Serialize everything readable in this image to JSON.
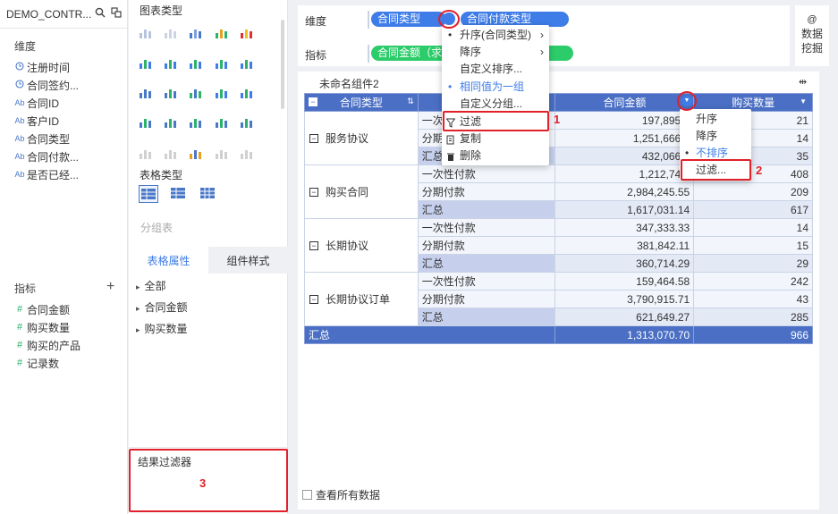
{
  "left": {
    "title": "DEMO_CONTR...",
    "dim_title": "维度",
    "dims": [
      {
        "icon": "clock-icon",
        "label": "注册时间"
      },
      {
        "icon": "clock-icon",
        "label": "合同签约..."
      },
      {
        "icon": "text-icon",
        "label": "合同ID"
      },
      {
        "icon": "text-icon",
        "label": "客户ID"
      },
      {
        "icon": "text-icon",
        "label": "合同类型"
      },
      {
        "icon": "text-icon",
        "label": "合同付款..."
      },
      {
        "icon": "text-icon",
        "label": "是否已经..."
      }
    ],
    "measure_title": "指标",
    "measures": [
      {
        "label": "合同金额"
      },
      {
        "label": "购买数量"
      },
      {
        "label": "购买的产品"
      },
      {
        "label": "记录数"
      }
    ],
    "text_icon": "Ab",
    "measure_icon": "#"
  },
  "mid": {
    "chart_type": "图表类型",
    "table_type": "表格类型",
    "group_table": "分组表",
    "tab_attr": "表格属性",
    "tab_style": "组件样式",
    "attrs": [
      "全部",
      "合同金额",
      "购买数量"
    ],
    "result_filter": "结果过滤器"
  },
  "config": {
    "dim_label": "维度",
    "dim_pills": [
      "合同类型",
      "合同付款类型"
    ],
    "measure_label": "指标",
    "measure_pill": "合同金额（求和）",
    "mining": "数据挖掘",
    "mining_icon_text": "@"
  },
  "widget": {
    "title": "未命名组件2"
  },
  "table": {
    "headers": [
      "合同类型",
      "合同付款类型",
      "合同金额",
      "购买数量"
    ],
    "groups": [
      {
        "name": "服务协议",
        "rows": [
          [
            "一次性付款",
            "197,895.2",
            "21"
          ],
          [
            "分期付款",
            "1,251,666.0",
            "14"
          ],
          [
            "汇总",
            "432,066.0",
            "35"
          ]
        ]
      },
      {
        "name": "购买合同",
        "rows": [
          [
            "一次性付款",
            "1,212,747.",
            "408"
          ],
          [
            "分期付款",
            "2,984,245.55",
            "209"
          ],
          [
            "汇总",
            "1,617,031.14",
            "617"
          ]
        ]
      },
      {
        "name": "长期协议",
        "rows": [
          [
            "一次性付款",
            "347,333.33",
            "14"
          ],
          [
            "分期付款",
            "381,842.11",
            "15"
          ],
          [
            "汇总",
            "360,714.29",
            "29"
          ]
        ]
      },
      {
        "name": "长期协议订单",
        "rows": [
          [
            "一次性付款",
            "159,464.58",
            "242"
          ],
          [
            "分期付款",
            "3,790,915.71",
            "43"
          ],
          [
            "汇总",
            "621,649.27",
            "285"
          ]
        ]
      }
    ],
    "total": [
      "汇总",
      "1,313,070.70",
      "966"
    ]
  },
  "menu1": {
    "items": [
      "升序(合同类型)",
      "降序",
      "自定义排序...",
      "相同值为一组",
      "自定义分组...",
      "过滤",
      "复制",
      "删除"
    ]
  },
  "menu2": {
    "items": [
      "升序",
      "降序",
      "不排序",
      "过滤..."
    ]
  },
  "annotations": [
    "1",
    "2",
    "3"
  ],
  "footer": {
    "view_all": "查看所有数据"
  },
  "colors": {
    "accent": "#3e7ce8",
    "table_head": "#4a6fc4",
    "measure_pill": "#2ccc6a",
    "annotation": "#e0202a"
  }
}
